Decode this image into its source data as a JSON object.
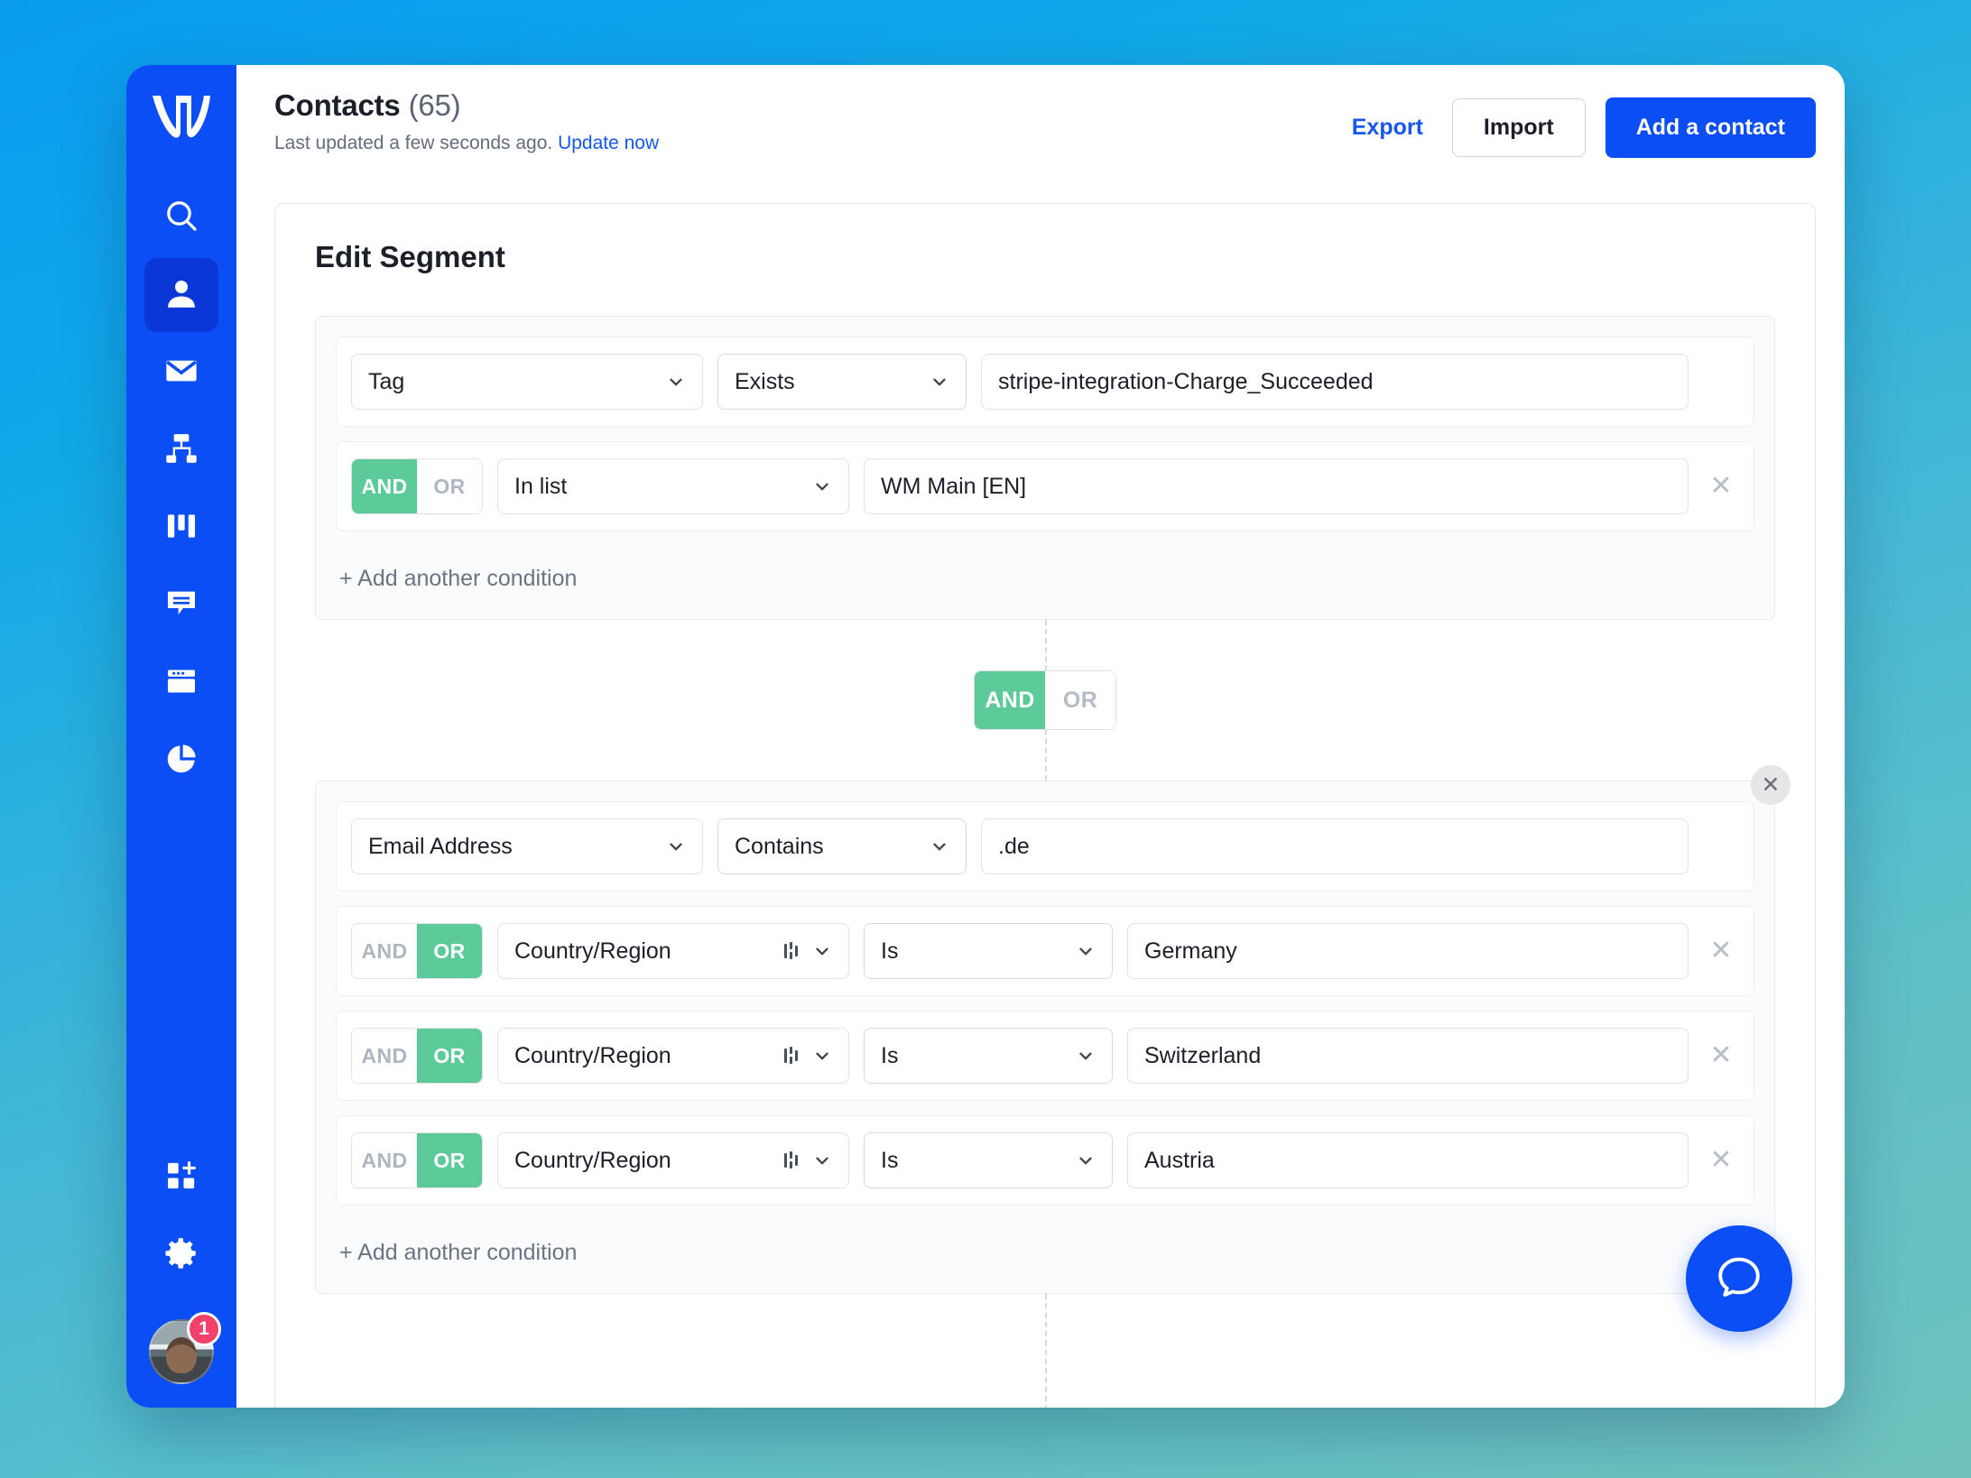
{
  "sidebar": {
    "logo_name": "logo-w",
    "items": [
      {
        "icon": "search-icon",
        "name": "sidebar-item-search",
        "active": false
      },
      {
        "icon": "person-icon",
        "name": "sidebar-item-contacts",
        "active": true
      },
      {
        "icon": "envelope-icon",
        "name": "sidebar-item-campaigns",
        "active": false
      },
      {
        "icon": "workflow-icon",
        "name": "sidebar-item-workflows",
        "active": false
      },
      {
        "icon": "columns-icon",
        "name": "sidebar-item-boards",
        "active": false
      },
      {
        "icon": "chat-icon",
        "name": "sidebar-item-conversations",
        "active": false
      },
      {
        "icon": "window-icon",
        "name": "sidebar-item-pages",
        "active": false
      },
      {
        "icon": "pie-chart-icon",
        "name": "sidebar-item-reports",
        "active": false
      }
    ],
    "bottom": [
      {
        "icon": "apps-add-icon",
        "name": "sidebar-item-apps"
      },
      {
        "icon": "gear-icon",
        "name": "sidebar-item-settings"
      }
    ],
    "avatar_badge": "1"
  },
  "header": {
    "title": "Contacts",
    "count": "(65)",
    "subtitle_text": "Last updated a few seconds ago.",
    "subtitle_link": "Update now",
    "export_label": "Export",
    "import_label": "Import",
    "add_contact_label": "Add a contact"
  },
  "segment": {
    "title": "Edit Segment",
    "group_join": {
      "and_label": "AND",
      "or_label": "OR",
      "selected": "AND"
    },
    "groups": [
      {
        "add_condition_label": "+ Add another condition",
        "closable": false,
        "conditions": [
          {
            "join": null,
            "field": "Tag",
            "operator": "Exists",
            "value": "stripe-integration-Charge_Succeeded",
            "has_attr_icon": false,
            "removable": false
          },
          {
            "join": {
              "and_label": "AND",
              "or_label": "OR",
              "selected": "AND"
            },
            "field": "In list",
            "operator": null,
            "value": "WM Main [EN]",
            "has_attr_icon": false,
            "removable": true
          }
        ]
      },
      {
        "add_condition_label": "+ Add another condition",
        "closable": true,
        "conditions": [
          {
            "join": null,
            "field": "Email Address",
            "operator": "Contains",
            "value": ".de",
            "has_attr_icon": false,
            "removable": false
          },
          {
            "join": {
              "and_label": "AND",
              "or_label": "OR",
              "selected": "OR"
            },
            "field": "Country/Region",
            "operator": "Is",
            "value": "Germany",
            "has_attr_icon": true,
            "removable": true
          },
          {
            "join": {
              "and_label": "AND",
              "or_label": "OR",
              "selected": "OR"
            },
            "field": "Country/Region",
            "operator": "Is",
            "value": "Switzerland",
            "has_attr_icon": true,
            "removable": true
          },
          {
            "join": {
              "and_label": "AND",
              "or_label": "OR",
              "selected": "OR"
            },
            "field": "Country/Region",
            "operator": "Is",
            "value": "Austria",
            "has_attr_icon": true,
            "removable": true
          }
        ]
      }
    ]
  },
  "help": {
    "icon": "chat-bubble-icon"
  },
  "annotation": {
    "arrow_color": "#ee1b1b",
    "points_at": "tag-value-field"
  },
  "colors": {
    "brand_blue": "#0b4ef5",
    "link_blue": "#1657f0",
    "toggle_green": "#5ccb99",
    "badge_red": "#f2416b",
    "sidebar_active": "#0a37d6"
  }
}
